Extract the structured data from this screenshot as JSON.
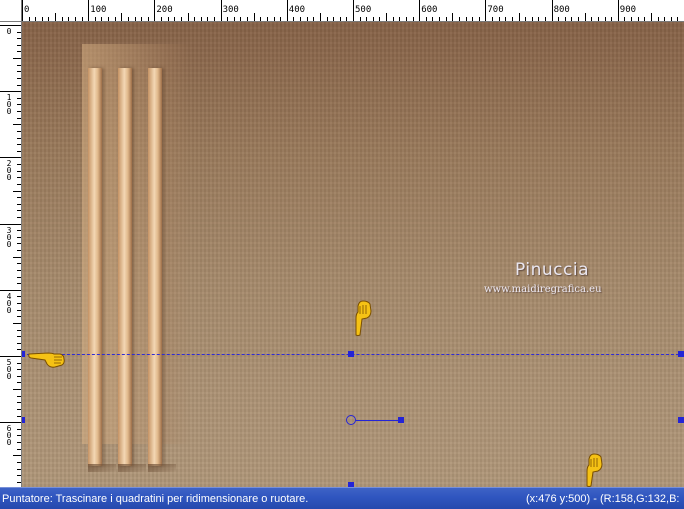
{
  "ruler": {
    "top_labels": [
      "0",
      "100",
      "200",
      "300",
      "400",
      "500",
      "600",
      "700",
      "800",
      "900"
    ],
    "left_labels": [
      "0",
      "100",
      "200",
      "300",
      "400",
      "500",
      "600"
    ]
  },
  "canvas": {
    "watermark_title": "Pinuccia",
    "watermark_url": "www.maidiregrafica.eu"
  },
  "statusbar": {
    "hint": "Puntatore: Trascinare i quadratini per ridimensionare o ruotare.",
    "coords": "(x:476 y:500) - (R:158,G:132,B:"
  },
  "icons": {
    "pointer_hand": "pointing-hand-icon"
  },
  "colors": {
    "guide": "#2d2bd8",
    "statusbar": "#2f55bf"
  }
}
